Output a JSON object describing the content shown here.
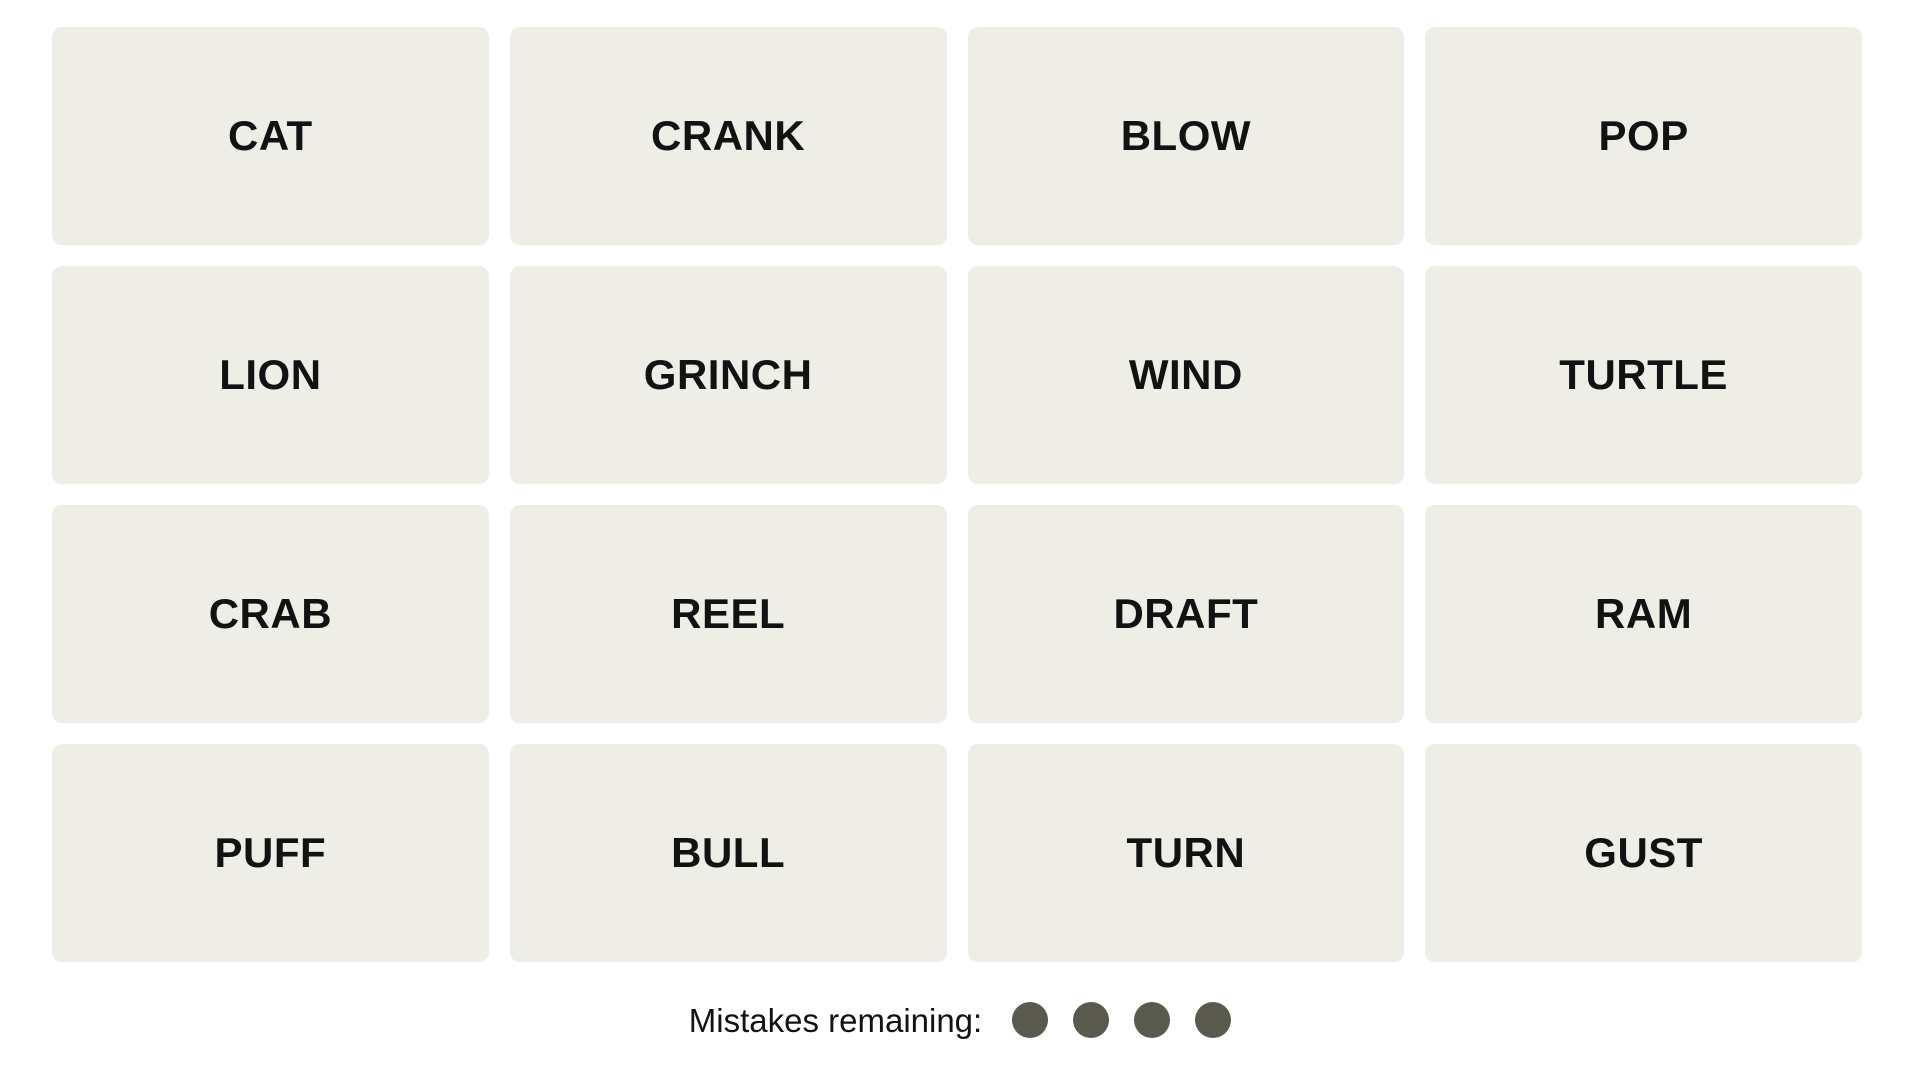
{
  "board": {
    "rows": 4,
    "columns": 4,
    "tile_color": "#efeee6",
    "tile_text_color": "#121212",
    "background_color": "#ffffff",
    "tiles": [
      {
        "label": "CAT"
      },
      {
        "label": "CRANK"
      },
      {
        "label": "BLOW"
      },
      {
        "label": "POP"
      },
      {
        "label": "LION"
      },
      {
        "label": "GRINCH"
      },
      {
        "label": "WIND"
      },
      {
        "label": "TURTLE"
      },
      {
        "label": "CRAB"
      },
      {
        "label": "REEL"
      },
      {
        "label": "DRAFT"
      },
      {
        "label": "RAM"
      },
      {
        "label": "PUFF"
      },
      {
        "label": "BULL"
      },
      {
        "label": "TURN"
      },
      {
        "label": "GUST"
      }
    ]
  },
  "mistakes": {
    "label": "Mistakes remaining:",
    "remaining": 4,
    "dot_color": "#5a594e",
    "dots": [
      {
        "name": "mistake-dot-1",
        "filled": true
      },
      {
        "name": "mistake-dot-2",
        "filled": true
      },
      {
        "name": "mistake-dot-3",
        "filled": true
      },
      {
        "name": "mistake-dot-4",
        "filled": true
      }
    ]
  }
}
